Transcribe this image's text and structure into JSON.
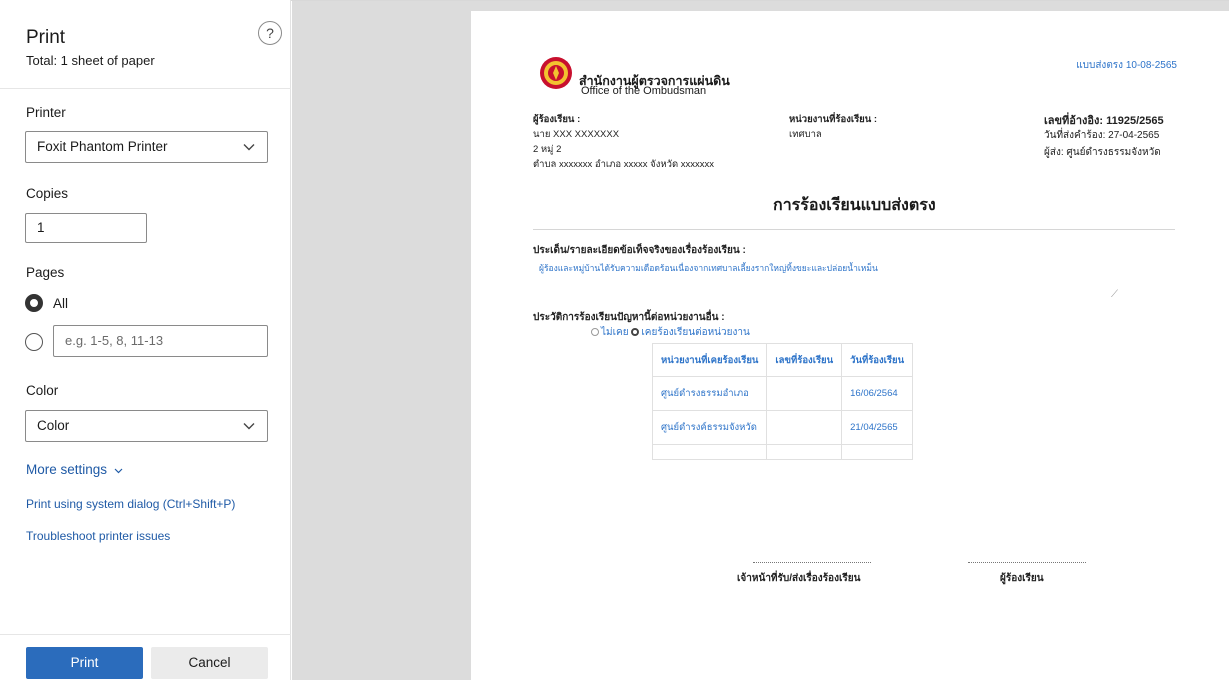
{
  "panel": {
    "title": "Print",
    "subtitle": "Total: 1 sheet of paper",
    "help_label": "?",
    "printer_label": "Printer",
    "printer_value": "Foxit Phantom Printer",
    "copies_label": "Copies",
    "copies_value": "1",
    "pages_label": "Pages",
    "pages_all_label": "All",
    "pages_range_placeholder": "e.g. 1-5, 8, 11-13",
    "color_label": "Color",
    "color_value": "Color",
    "more_settings": "More settings",
    "system_dialog": "Print using system dialog (Ctrl+Shift+P)",
    "troubleshoot": "Troubleshoot printer issues",
    "print_button": "Print",
    "cancel_button": "Cancel"
  },
  "document": {
    "form_code": "แบบส่งตรง 10-08-2565",
    "org_th": "สำนักงานผู้ตรวจการแผ่นดิน",
    "org_en": "Office of the Ombudsman",
    "complainant_label": "ผู้ร้องเรียน :",
    "complainant_name": "นาย XXX XXXXXXX",
    "address_line1": "2 หมู่ 2",
    "address_line2": "ตำบล xxxxxxx    อำเภอ xxxxx   จังหวัด xxxxxxx",
    "agency_label": "หน่วยงานที่ร้องเรียน :",
    "agency_value": "เทศบาล",
    "ref_no": "เลขที่อ้างอิง: 11925/2565",
    "sent_date": "วันที่ส่งคำร้อง: 27-04-2565",
    "sender": "ผู้ส่ง: ศูนย์ดำรงธรรมจังหวัด",
    "title": "การร้องเรียนแบบส่งตรง",
    "issue_label": "ประเด็น/รายละเอียดข้อเท็จจริงของเรื่องร้องเรียน :",
    "issue_text": "ผู้ร้องและหมู่บ้านได้รับความเดือดร้อนเนื่องจากเทศบาลเลี้ยงรากใหญ่ทิ้งขยะและปล่อยน้ำเหม็น",
    "history_label": "ประวัติการร้องเรียนปัญหานี้ต่อหน่วยงานอื่น :",
    "radio_never": "ไม่เคย",
    "radio_ever": "เคยร้องเรียนต่อหน่วยงาน",
    "table_headers": [
      "หน่วยงานที่เคยร้องเรียน",
      "เลขที่ร้องเรียน",
      "วันที่ร้องเรียน"
    ],
    "table_rows": [
      [
        "ศูนย์ดำรงธรรมอำเภอ",
        "",
        "16/06/2564"
      ],
      [
        "ศูนย์ดำรงค์ธรรมจังหวัด",
        "",
        "21/04/2565"
      ]
    ],
    "sig_officer": "เจ้าหน้าที่รับ/ส่งเรื่องร้องเรียน",
    "sig_complainant": "ผู้ร้องเรียน"
  },
  "colors": {
    "primary_button": "#2b6cbc",
    "link": "#1f5aa6",
    "doc_blue": "#2e74c9",
    "preview_bg": "#dcdcdc"
  },
  "icons": [
    "help-icon",
    "chevron-down-icon",
    "ombudsman-seal-logo",
    "resize-handle-icon"
  ]
}
